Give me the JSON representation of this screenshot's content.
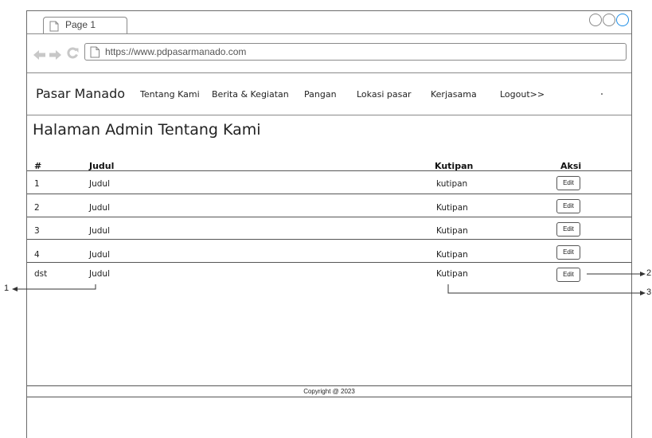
{
  "browser": {
    "tab_label": "Page 1",
    "url": "https://www.pdpasarmanado.com"
  },
  "site": {
    "brand": "Pasar Manado",
    "menu": [
      "Tentang Kami",
      "Berita & Kegiatan",
      "Pangan",
      "Lokasi pasar",
      "Kerjasama",
      "Logout>>"
    ]
  },
  "page": {
    "heading": "Halaman Admin Tentang Kami"
  },
  "table": {
    "headers": {
      "num": "#",
      "title": "Judul",
      "quote": "Kutipan",
      "action": "Aksi"
    },
    "rows": [
      {
        "num": "1",
        "title": "Judul",
        "quote": "kutipan",
        "action": "Edit"
      },
      {
        "num": "2",
        "title": "Judul",
        "quote": "Kutipan",
        "action": "Edit"
      },
      {
        "num": "3",
        "title": "Judul",
        "quote": "Kutipan",
        "action": "Edit"
      },
      {
        "num": "4",
        "title": "Judul",
        "quote": "Kutipan",
        "action": "Edit"
      },
      {
        "num": "dst",
        "title": "Judul",
        "quote": "Kutipan",
        "action": "Edit"
      }
    ]
  },
  "footer": {
    "copyright": "Copyright @ 2023"
  },
  "callouts": {
    "left": "1",
    "edit": "2",
    "quote": "3"
  },
  "icons": {
    "back": "arrow-left-icon",
    "forward": "arrow-right-icon",
    "reload": "reload-icon",
    "page": "page-icon"
  },
  "colors": {
    "accent_circle": "#1e8ee6",
    "arrows": "#c8c8c8"
  }
}
